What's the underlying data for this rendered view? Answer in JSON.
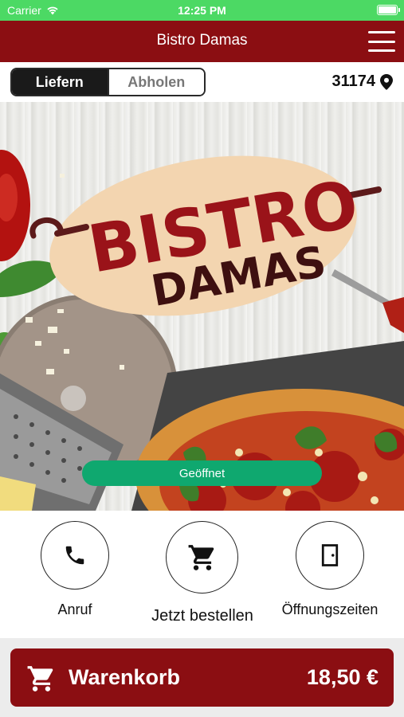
{
  "status_bar": {
    "carrier": "Carrier",
    "time": "12:25 PM"
  },
  "nav": {
    "title": "Bistro Damas",
    "menu_icon": "hamburger-menu-icon"
  },
  "delivery": {
    "options": [
      {
        "label": "Liefern",
        "selected": true
      },
      {
        "label": "Abholen",
        "selected": false
      }
    ],
    "zip": "31174",
    "zip_icon": "location-pin-icon"
  },
  "hero": {
    "logo_line1": "BISTRO",
    "logo_line2": "DAMAS",
    "status": "Geöffnet",
    "status_color": "#0fa86f"
  },
  "actions": [
    {
      "label": "Anruf",
      "icon": "phone-icon"
    },
    {
      "label": "Jetzt bestellen",
      "icon": "shopping-cart-icon"
    },
    {
      "label": "Öffnungszeiten",
      "icon": "door-icon"
    }
  ],
  "cart": {
    "label": "Warenkorb",
    "total": "18,50 €",
    "icon": "shopping-cart-icon"
  },
  "colors": {
    "brand": "#8b0e12",
    "status_bar": "#4cd964",
    "open": "#0fa86f"
  }
}
